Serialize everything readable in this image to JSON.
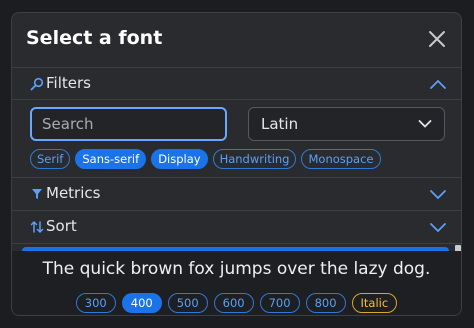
{
  "dialog": {
    "title": "Select a font"
  },
  "sections": {
    "filters": {
      "label": "Filters",
      "expanded": true
    },
    "metrics": {
      "label": "Metrics",
      "expanded": false
    },
    "sort": {
      "label": "Sort",
      "expanded": false
    }
  },
  "search": {
    "placeholder": "Search",
    "value": ""
  },
  "script_select": {
    "value": "Latin"
  },
  "categories": [
    {
      "label": "Serif",
      "selected": false
    },
    {
      "label": "Sans-serif",
      "selected": true
    },
    {
      "label": "Display",
      "selected": true
    },
    {
      "label": "Handwriting",
      "selected": false
    },
    {
      "label": "Monospace",
      "selected": false
    }
  ],
  "preview": {
    "text": "The quick brown fox jumps over the lazy dog."
  },
  "weights": [
    {
      "label": "300",
      "selected": false
    },
    {
      "label": "400",
      "selected": true
    },
    {
      "label": "500",
      "selected": false
    },
    {
      "label": "600",
      "selected": false
    },
    {
      "label": "700",
      "selected": false
    },
    {
      "label": "800",
      "selected": false
    }
  ],
  "italic": {
    "label": "Italic"
  },
  "colors": {
    "accent": "#1a73e8",
    "italic_accent": "#f0c040",
    "background": "#2a2b2f"
  }
}
